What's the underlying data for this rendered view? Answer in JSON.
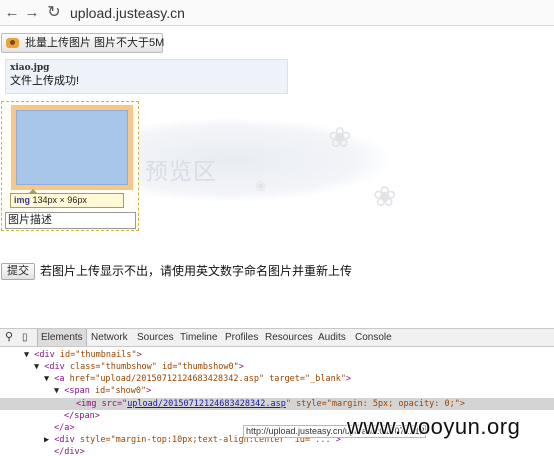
{
  "browser": {
    "url": "upload.justeasy.cn"
  },
  "page": {
    "upload_button": "批量上传图片 图片不大于5M",
    "file_name": "xiao.jpg",
    "status_message": "文件上传成功!",
    "preview_label": "预览区",
    "tooltip_tag": "img",
    "tooltip_size": "134px × 96px",
    "description_value": "图片描述",
    "submit_label": "提交",
    "hint": "若图片上传显示不出，请使用英文数字命名图片并重新上传"
  },
  "devtools": {
    "tabs": [
      "Elements",
      "Network",
      "Sources",
      "Timeline",
      "Profiles",
      "Resources",
      "Audits",
      "Console"
    ],
    "dom": {
      "l1": {
        "open": "<div ",
        "attrs": "id=\"thumbnails\"",
        "close": ">"
      },
      "l2": {
        "open": "<div ",
        "attrs": "class=\"thumbshow\" id=\"thumbshow0\"",
        "close": ">"
      },
      "l3": {
        "open": "<a ",
        "attrs": "href=\"upload/20150712124683428342.asp\" target=\"_blank\"",
        "close": ">"
      },
      "l4": {
        "open": "<span ",
        "attrs": "id=\"show0\"",
        "close": ">"
      },
      "l5": {
        "open": "<img src=\"",
        "link": "upload/20150712124683428342.asp",
        "rest": "\" style=\"margin: 5px; opacity: 0;\">"
      },
      "l6": "</span>",
      "l7": "</a>",
      "l8": {
        "open": "<div ",
        "attrs": "style=\"margin-top:10px;text-align:center\" id=\"...\"",
        "close": ">"
      },
      "l9": "</div>"
    },
    "url_tooltip": "http://upload.justeasy.cn/upload/20150712124683428342.asp"
  },
  "watermark": "www.wooyun.org"
}
